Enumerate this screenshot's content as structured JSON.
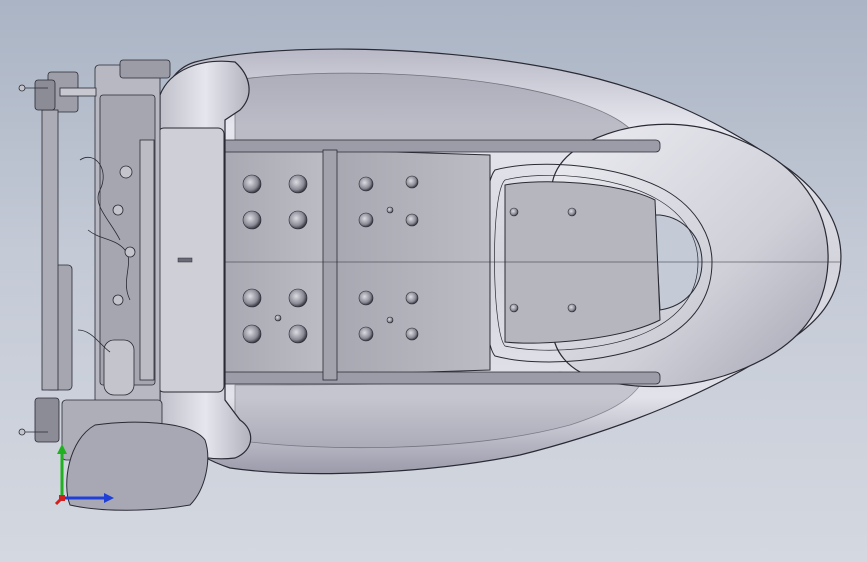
{
  "viewport": {
    "background_top": "#aab4c4",
    "background_bottom": "#d4d8e0"
  },
  "model": {
    "subject": "seat-assembly-cad-model",
    "shell_color": "#d8d8e0",
    "shell_shadow": "#9e9eae",
    "edge_color": "#2a2a34",
    "panel_color": "#b4b4bc"
  },
  "triad": {
    "x_axis_color": "#1f3fd8",
    "y_axis_color": "#20b020",
    "z_axis_color": "#d02020"
  }
}
